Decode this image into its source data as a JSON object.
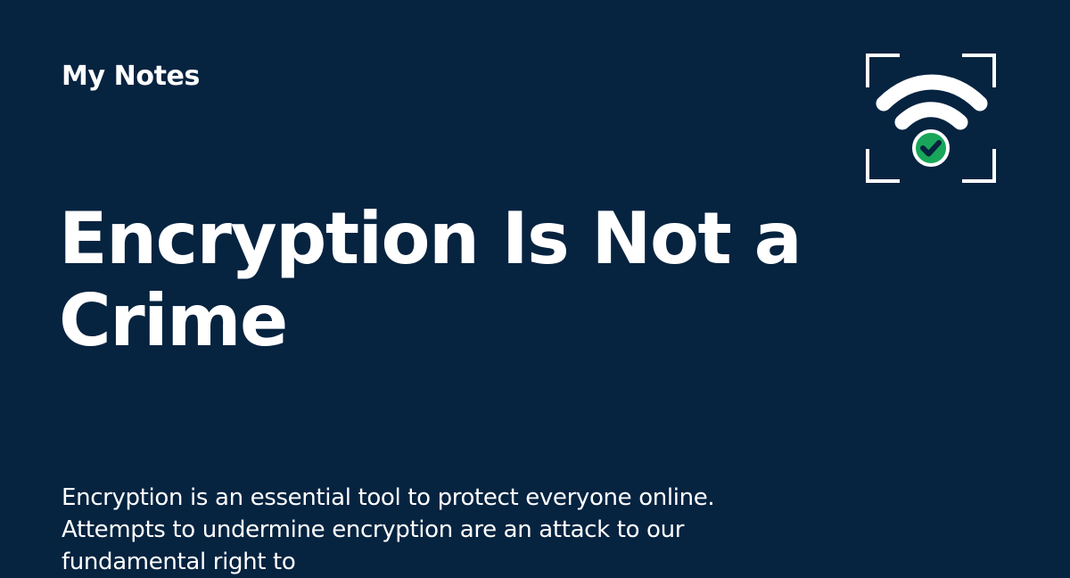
{
  "site": {
    "name": "My Notes"
  },
  "post": {
    "title": "Encryption Is Not a Crime",
    "excerpt": "Encryption is an essential tool to protect everyone online. Attempts to undermine encryption are an attack to our fundamental right to"
  },
  "logo": {
    "icon": "secure-wifi-icon"
  },
  "colors": {
    "background": "#062340",
    "text": "#ffffff",
    "check_badge": "#18A65A"
  }
}
